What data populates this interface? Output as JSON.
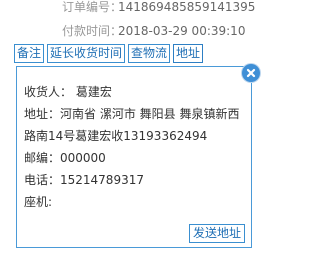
{
  "order": {
    "order_no_label": "订单编号：",
    "order_no": "141869485859141395",
    "pay_time_label": "付款时间：",
    "pay_time": "2018-03-29 00:39:10"
  },
  "buttons": {
    "remark": "备注",
    "extend_receipt": "延长收货时间",
    "check_logistics": "查物流",
    "address": "地址"
  },
  "address_popup": {
    "receiver": "收货人：  葛建宏",
    "address": "地址：河南省 漯河市 舞阳县 舞泉镇新西路南14号葛建宏收13193362494",
    "postcode": "邮编：000000",
    "phone": "电话：15214789317",
    "landline": "座机:",
    "send_button": "发送地址",
    "close_icon": "close-icon"
  },
  "colors": {
    "accent": "#3a8fd0",
    "close_bg": "#3f8fd6"
  }
}
